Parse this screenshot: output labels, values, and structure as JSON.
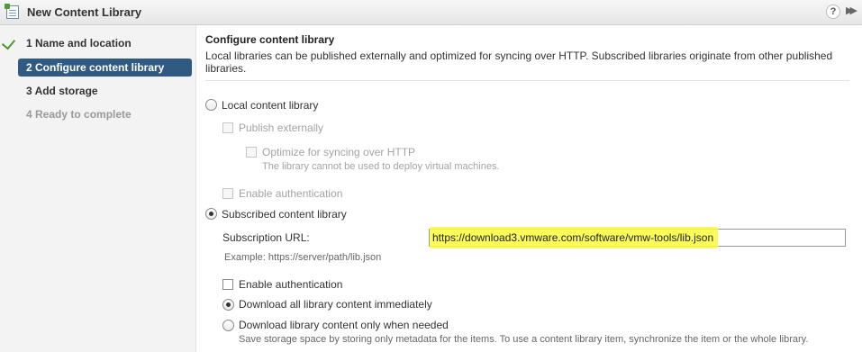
{
  "window": {
    "title": "New Content Library"
  },
  "steps": [
    {
      "label": "1  Name and location",
      "state": "completed"
    },
    {
      "label": "2  Configure content library",
      "state": "active"
    },
    {
      "label": "3  Add storage",
      "state": "pending"
    },
    {
      "label": "4  Ready to complete",
      "state": "disabled"
    }
  ],
  "main": {
    "title": "Configure content library",
    "description": "Local libraries can be published externally and optimized for syncing over HTTP. Subscribed libraries originate from other published libraries.",
    "local_option": {
      "label": "Local content library",
      "selected": false,
      "publish_label": "Publish externally",
      "optimize_label": "Optimize for syncing over HTTP",
      "optimize_note": "The library cannot be used to deploy virtual machines.",
      "auth_label": "Enable authentication"
    },
    "subscribed_option": {
      "label": "Subscribed content library",
      "selected": true,
      "url_label": "Subscription URL:",
      "url_value": "https://download3.vmware.com/software/vmw-tools/lib.json",
      "url_example": "Example: https://server/path/lib.json",
      "auth_label": "Enable authentication",
      "download_all_label": "Download all library content immediately",
      "download_all_selected": true,
      "download_needed_label": "Download library content only when needed",
      "download_needed_note": "Save storage space by storing only metadata for the items. To use a content library item, synchronize the item or the whole library."
    }
  },
  "colors": {
    "active_step": "#315a83",
    "highlight": "#fafa3c",
    "check": "#4a9b2f"
  }
}
